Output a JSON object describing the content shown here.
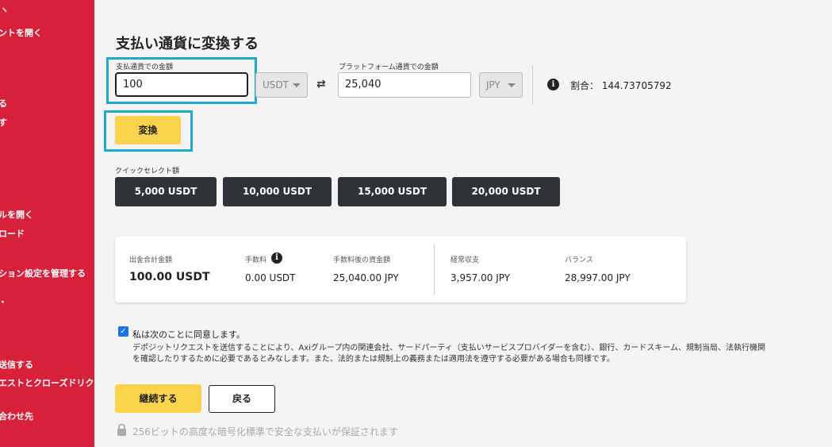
{
  "sidebar": {
    "items": [
      {
        "label": "ントを開く"
      },
      {
        "label": "る"
      },
      {
        "label": "す"
      },
      {
        "label": "ルを開く"
      },
      {
        "label": "ロード"
      },
      {
        "label": "ション設定を管理する"
      },
      {
        "label": "送信する"
      },
      {
        "label": "エストとクローズドリク"
      },
      {
        "label": "合わせ先"
      }
    ]
  },
  "page": {
    "title": "支払い通貨に変換する"
  },
  "convert": {
    "pay_label": "支払通貨での金額",
    "pay_value": "100",
    "pay_currency": "USDT",
    "platform_label": "プラットフォーム通貨での金額",
    "platform_value": "25,040",
    "platform_currency": "JPY",
    "rate_text": "割合： 144.73705792",
    "convert_button": "変換"
  },
  "quick_select": {
    "label": "クイックセレクト額",
    "options": [
      "5,000 USDT",
      "10,000 USDT",
      "15,000 USDT",
      "20,000 USDT"
    ]
  },
  "summary": {
    "total_label": "出金合計金額",
    "total_value": "100.00 USDT",
    "fee_label": "手数料",
    "fee_value": "0.00 USDT",
    "after_fee_label": "手数料後の資金額",
    "after_fee_value": "25,040.00 JPY",
    "balance_label": "経常収支",
    "balance_value": "3,957.00 JPY",
    "equity_label": "バランス",
    "equity_value": "28,997.00 JPY"
  },
  "agreement": {
    "checked": true,
    "title": "私は次のことに同意します。",
    "line1": "デポジットリクエストを送信することにより、Axiグループ内の関連会社、サードパーティ（支払いサービスプロバイダーを含む）、銀行、カードスキーム、規制当局、法執行機関",
    "line2": "を確認したりするために必要であるとみなします。また、法的または規制上の義務または適用法を遵守する必要がある場合も同様です。"
  },
  "actions": {
    "continue": "継続する",
    "back": "戻る"
  },
  "footer": {
    "secure_text": "256ビットの高度な暗号化標準で安全な支払いが保証されます"
  },
  "colors": {
    "sidebar": "#d7213b",
    "accent_yellow": "#fcd34d",
    "highlight": "#1eaacb",
    "dark_button": "#2f3338"
  }
}
